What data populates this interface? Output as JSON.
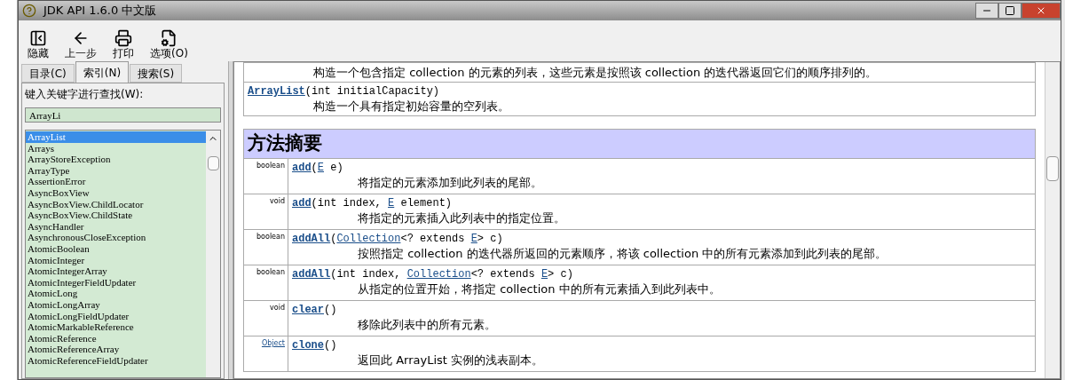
{
  "window": {
    "title": "JDK API 1.6.0 中文版"
  },
  "toolbar": [
    {
      "kind": "hide",
      "label": "隐藏"
    },
    {
      "kind": "back",
      "label": "上一步"
    },
    {
      "kind": "print",
      "label": "打印"
    },
    {
      "kind": "options",
      "label": "选项(O)"
    }
  ],
  "tabs": [
    {
      "label": "目录(C)",
      "selected": false
    },
    {
      "label": "索引(N)",
      "selected": true
    },
    {
      "label": "搜索(S)",
      "selected": false
    }
  ],
  "search": {
    "label": "键入关键字进行查找(W):",
    "value": "ArrayLi"
  },
  "index_list": [
    {
      "label": "ArrayList",
      "selected": true
    },
    {
      "label": "Arrays",
      "selected": false
    },
    {
      "label": "ArrayStoreException",
      "selected": false
    },
    {
      "label": "ArrayType",
      "selected": false
    },
    {
      "label": "AssertionError",
      "selected": false
    },
    {
      "label": "AsyncBoxView",
      "selected": false
    },
    {
      "label": "AsyncBoxView.ChildLocator",
      "selected": false
    },
    {
      "label": "AsyncBoxView.ChildState",
      "selected": false
    },
    {
      "label": "AsyncHandler",
      "selected": false
    },
    {
      "label": "AsynchronousCloseException",
      "selected": false
    },
    {
      "label": "AtomicBoolean",
      "selected": false
    },
    {
      "label": "AtomicInteger",
      "selected": false
    },
    {
      "label": "AtomicIntegerArray",
      "selected": false
    },
    {
      "label": "AtomicIntegerFieldUpdater",
      "selected": false
    },
    {
      "label": "AtomicLong",
      "selected": false
    },
    {
      "label": "AtomicLongArray",
      "selected": false
    },
    {
      "label": "AtomicLongFieldUpdater",
      "selected": false
    },
    {
      "label": "AtomicMarkableReference",
      "selected": false
    },
    {
      "label": "AtomicReference",
      "selected": false
    },
    {
      "label": "AtomicReferenceArray",
      "selected": false
    },
    {
      "label": "AtomicReferenceFieldUpdater",
      "selected": false
    }
  ],
  "constructors": [
    {
      "description": "构造一个包含指定 collection 的元素的列表，这些元素是按照该 collection 的迭代器返回它们的顺序排列的。"
    },
    {
      "signature": [
        {
          "kind": "name",
          "text": "ArrayList"
        },
        {
          "kind": "plain",
          "text": "(int initialCapacity)"
        }
      ],
      "description": "构造一个具有指定初始容量的空列表。"
    }
  ],
  "method_summary": {
    "heading": "方法摘要",
    "rows": [
      {
        "return_type": "boolean",
        "return_link": false,
        "signature": [
          {
            "kind": "name",
            "text": "add"
          },
          {
            "kind": "plain",
            "text": "("
          },
          {
            "kind": "type",
            "text": "E"
          },
          {
            "kind": "plain",
            "text": " e)"
          }
        ],
        "description": "将指定的元素添加到此列表的尾部。"
      },
      {
        "return_type": "void",
        "return_link": false,
        "signature": [
          {
            "kind": "name",
            "text": "add"
          },
          {
            "kind": "plain",
            "text": "(int index, "
          },
          {
            "kind": "type",
            "text": "E"
          },
          {
            "kind": "plain",
            "text": " element)"
          }
        ],
        "description": "将指定的元素插入此列表中的指定位置。"
      },
      {
        "return_type": "boolean",
        "return_link": false,
        "signature": [
          {
            "kind": "name",
            "text": "addAll"
          },
          {
            "kind": "plain",
            "text": "("
          },
          {
            "kind": "type",
            "text": "Collection"
          },
          {
            "kind": "plain",
            "text": "<? extends "
          },
          {
            "kind": "type",
            "text": "E"
          },
          {
            "kind": "plain",
            "text": "> c)"
          }
        ],
        "description": "按照指定 collection 的迭代器所返回的元素顺序，将该 collection 中的所有元素添加到此列表的尾部。"
      },
      {
        "return_type": "boolean",
        "return_link": false,
        "signature": [
          {
            "kind": "name",
            "text": "addAll"
          },
          {
            "kind": "plain",
            "text": "(int index, "
          },
          {
            "kind": "type",
            "text": "Collection"
          },
          {
            "kind": "plain",
            "text": "<? extends "
          },
          {
            "kind": "type",
            "text": "E"
          },
          {
            "kind": "plain",
            "text": "> c)"
          }
        ],
        "description": "从指定的位置开始，将指定 collection 中的所有元素插入到此列表中。"
      },
      {
        "return_type": "void",
        "return_link": false,
        "signature": [
          {
            "kind": "name",
            "text": "clear"
          },
          {
            "kind": "plain",
            "text": "()"
          }
        ],
        "description": "移除此列表中的所有元素。"
      },
      {
        "return_type": "Object",
        "return_link": true,
        "signature": [
          {
            "kind": "name",
            "text": "clone"
          },
          {
            "kind": "plain",
            "text": "()"
          }
        ],
        "description": "返回此 ArrayList 实例的浅表副本。"
      }
    ]
  }
}
